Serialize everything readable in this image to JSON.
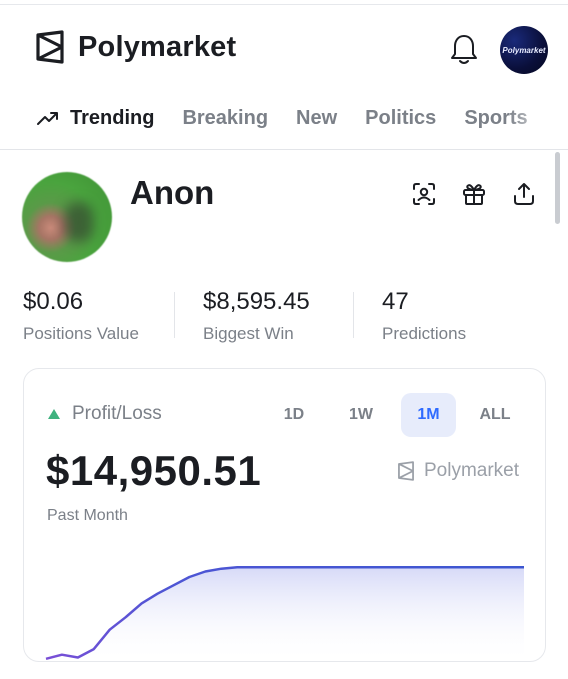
{
  "header": {
    "brand": "Polymarket",
    "avatar_text": "Polymarket"
  },
  "tabs": [
    {
      "label": "Trending",
      "active": true
    },
    {
      "label": "Breaking",
      "active": false
    },
    {
      "label": "New",
      "active": false
    },
    {
      "label": "Politics",
      "active": false
    },
    {
      "label": "Sports",
      "active": false
    }
  ],
  "profile": {
    "name": "Anon",
    "actions": [
      "scan-face-icon",
      "gift-icon",
      "share-icon"
    ]
  },
  "stats": [
    {
      "value": "$0.06",
      "label": "Positions Value"
    },
    {
      "value": "$8,595.45",
      "label": "Biggest Win"
    },
    {
      "value": "47",
      "label": "Predictions"
    }
  ],
  "pnl": {
    "label": "Profit/Loss",
    "value": "$14,950.51",
    "period": "Past Month",
    "watermark": "Polymarket",
    "ranges": [
      {
        "label": "1D",
        "active": false
      },
      {
        "label": "1W",
        "active": false
      },
      {
        "label": "1M",
        "active": true
      },
      {
        "label": "ALL",
        "active": false
      }
    ]
  },
  "colors": {
    "accent": "#2f6bff",
    "positive": "#3fb27f",
    "line": "#3c56d0"
  },
  "chart_data": {
    "type": "area",
    "x": [
      0,
      1,
      2,
      3,
      4,
      5,
      6,
      7,
      8,
      9,
      10,
      11,
      12,
      13,
      14,
      15,
      16,
      17,
      18,
      19,
      20,
      21,
      22,
      23,
      24,
      25,
      26,
      27,
      28,
      29,
      30
    ],
    "values": [
      0.3,
      0.6,
      0.4,
      1.0,
      2.4,
      3.3,
      4.3,
      5.0,
      5.6,
      6.2,
      6.6,
      6.8,
      6.9,
      6.9,
      6.9,
      6.9,
      6.9,
      6.9,
      6.9,
      6.9,
      6.9,
      6.9,
      6.9,
      6.9,
      6.9,
      6.9,
      6.9,
      6.9,
      6.9,
      6.9,
      6.9
    ],
    "ylim": [
      0,
      7.5
    ]
  }
}
